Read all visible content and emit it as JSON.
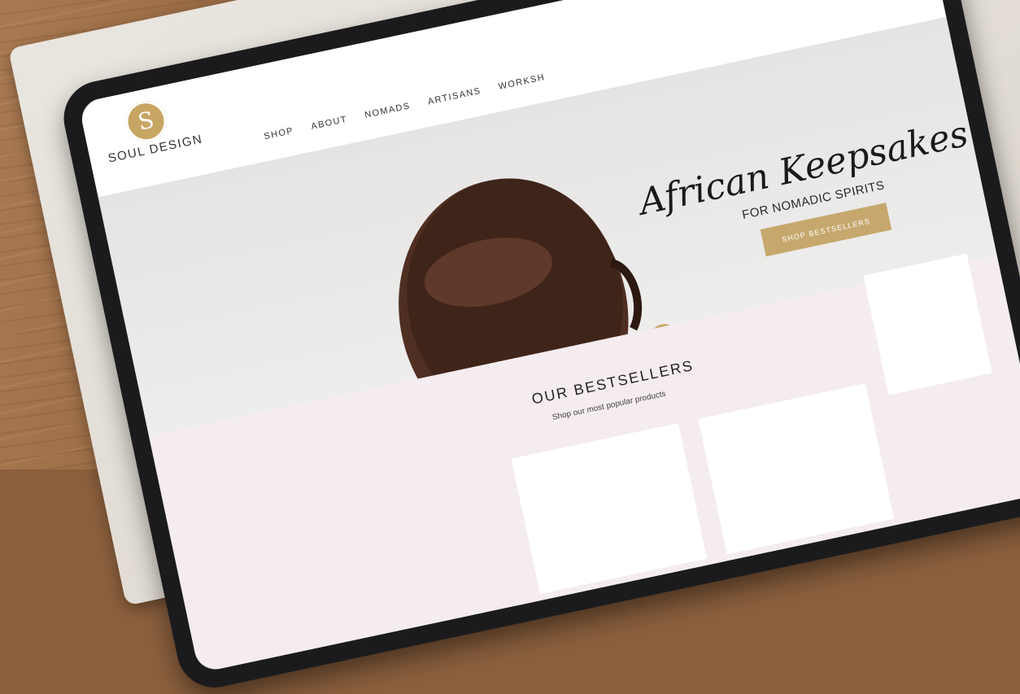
{
  "brand": {
    "logo_letter": "S",
    "name": "SOUL DESIGN"
  },
  "nav": {
    "items": [
      "SHOP",
      "ABOUT",
      "NOMADS",
      "ARTISANS",
      "WORKSH"
    ]
  },
  "hero": {
    "title": "African Keepsakes",
    "subtitle": "FOR NOMADIC SPIRITS",
    "cta_label": "SHOP BESTSELLERS"
  },
  "bestsellers": {
    "title": "OUR BESTSELLERS",
    "subtitle": "Shop our most popular products"
  },
  "colors": {
    "accent_gold": "#c6a86e",
    "hero_bg": "#e6e4e3",
    "section_pink": "#f4ecee",
    "tablet_bezel": "#1b1b1d"
  }
}
